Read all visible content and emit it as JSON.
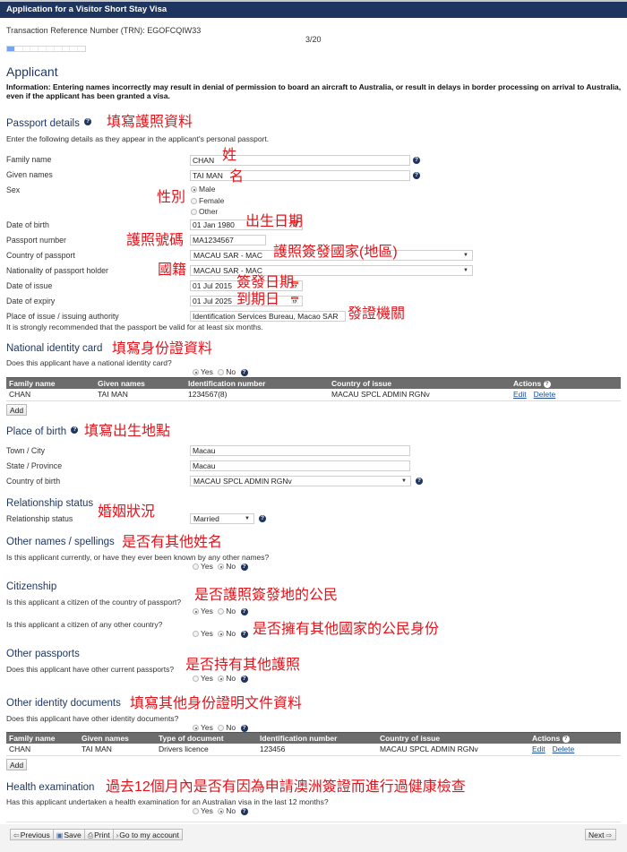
{
  "window": {
    "title": "Application for a Visitor Short Stay Visa"
  },
  "header": {
    "trn_label": "Transaction Reference Number (TRN): EGOFCQIW33",
    "page_count": "3/20",
    "progress": {
      "current_page": 3,
      "total_pages": 20,
      "segments_total": 10,
      "segments_filled": 1
    }
  },
  "applicant": {
    "title": "Applicant",
    "info": "Information: Entering names incorrectly may result in denial of permission to board an aircraft to Australia, or result in delays in border processing on arrival to Australia, even if the applicant has been granted a visa."
  },
  "passport": {
    "title": "Passport details",
    "note": "填寫護照資料",
    "intro": "Enter the following details as they appear in the applicant's personal passport.",
    "family_name": {
      "label": "Family name",
      "value": "CHAN",
      "note": "姓"
    },
    "given_names": {
      "label": "Given names",
      "value": "TAI MAN",
      "note": "名"
    },
    "sex": {
      "label": "Sex",
      "note": "性別",
      "options": [
        "Male",
        "Female",
        "Other"
      ],
      "selected": "Male"
    },
    "dob": {
      "label": "Date of birth",
      "value": "01 Jan 1980",
      "note": "出生日期"
    },
    "number": {
      "label": "Passport number",
      "value": "MA1234567",
      "note": "護照號碼"
    },
    "country": {
      "label": "Country of passport",
      "value": "MACAU SAR - MAC",
      "note": "護照簽發國家(地區)"
    },
    "nationality": {
      "label": "Nationality of passport holder",
      "value": "MACAU SAR - MAC",
      "note": "國籍"
    },
    "issue_date": {
      "label": "Date of issue",
      "value": "01 Jul 2015",
      "note": "簽發日期"
    },
    "expiry_date": {
      "label": "Date of expiry",
      "value": "01 Jul 2025",
      "note": "到期日"
    },
    "authority": {
      "label": "Place of issue / issuing authority",
      "value": "Identification Services Bureau, Macao SAR",
      "note": "發證機關"
    },
    "validity_note": "It is strongly recommended that the passport be valid for at least six months."
  },
  "national_id": {
    "title": "National identity card",
    "note": "填寫身份證資料",
    "question": "Does this applicant have a national identity card?",
    "answer": "Yes",
    "columns": [
      "Family name",
      "Given names",
      "Identification number",
      "Country of issue",
      "Actions"
    ],
    "rows": [
      {
        "family": "CHAN",
        "given": "TAI MAN",
        "id": "1234567(8)",
        "country": "MACAU SPCL ADMIN RGNv",
        "edit": "Edit",
        "delete": "Delete"
      }
    ],
    "add_label": "Add"
  },
  "birth": {
    "title": "Place of birth",
    "note": "填寫出生地點",
    "town": {
      "label": "Town / City",
      "value": "Macau"
    },
    "state": {
      "label": "State / Province",
      "value": "Macau"
    },
    "country": {
      "label": "Country of birth",
      "value": "MACAU SPCL ADMIN RGNv"
    }
  },
  "relationship": {
    "title": "Relationship status",
    "note": "婚姻狀況",
    "label": "Relationship status",
    "value": "Married"
  },
  "other_names": {
    "title": "Other names / spellings",
    "note": "是否有其他姓名",
    "question": "Is this applicant currently, or have they ever been known by any other names?",
    "answer": "No"
  },
  "citizenship": {
    "title": "Citizenship",
    "q1": "Is this applicant a citizen of the country of passport?",
    "q1_note": "是否護照簽發地的公民",
    "q1_answer": "Yes",
    "q2": "Is this applicant a citizen of any other country?",
    "q2_note": "是否擁有其他國家的公民身份",
    "q2_answer": "No"
  },
  "other_passports": {
    "title": "Other passports",
    "question": "Does this applicant have other current passports?",
    "note": "是否持有其他護照",
    "answer": "No"
  },
  "other_docs": {
    "title": "Other identity documents",
    "note": "填寫其他身份證明文件資料",
    "question": "Does this applicant have other identity documents?",
    "answer": "Yes",
    "columns": [
      "Family name",
      "Given names",
      "Type of document",
      "Identification number",
      "Country of issue",
      "Actions"
    ],
    "rows": [
      {
        "family": "CHAN",
        "given": "TAI MAN",
        "type": "Drivers licence",
        "id": "123456",
        "country": "MACAU SPCL ADMIN RGNv",
        "edit": "Edit",
        "delete": "Delete"
      }
    ],
    "add_label": "Add"
  },
  "health": {
    "title": "Health examination",
    "note": "過去12個月內是否有因為申請澳洲簽證而進行過健康檢查",
    "question": "Has this applicant undertaken a health examination for an Australian visa in the last 12 months?",
    "answer": "No"
  },
  "radio_labels": {
    "yes": "Yes",
    "no": "No"
  },
  "footer": {
    "previous": "Previous",
    "save": "Save",
    "print": "Print",
    "account": "Go to my account",
    "next": "Next"
  },
  "colors": {
    "brand": "#1d355f",
    "annotation": "#e0141b",
    "table_header": "#6c6c6c",
    "progress_fill": "#75a5ef"
  }
}
